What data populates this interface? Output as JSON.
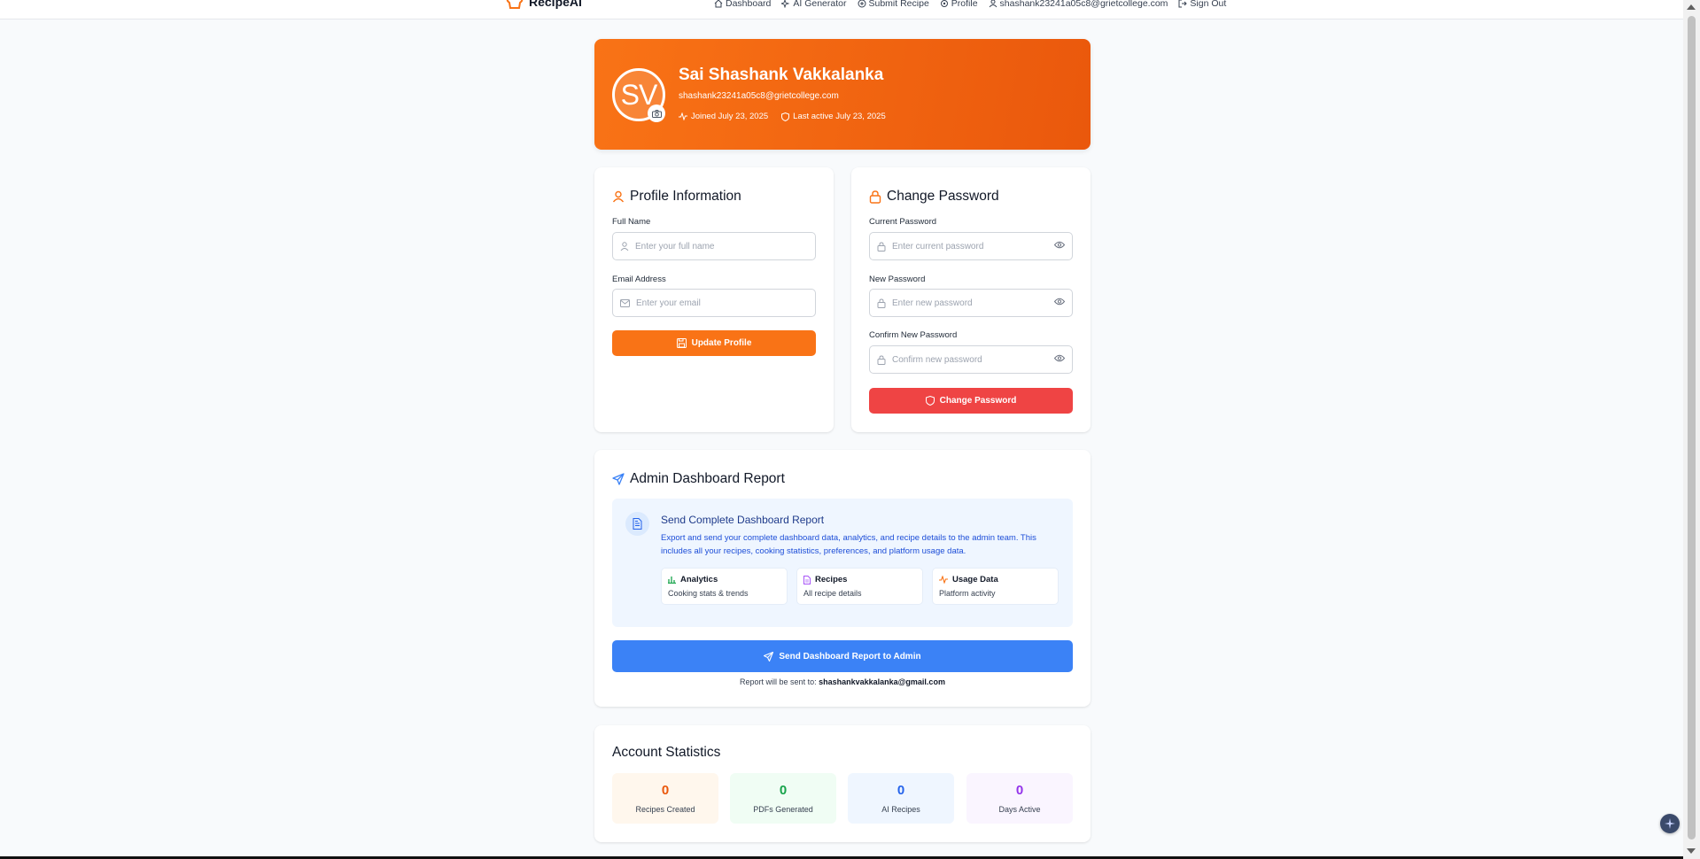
{
  "brand": {
    "name": "RecipeAI"
  },
  "nav": {
    "items": [
      {
        "label": "Dashboard",
        "icon": "home-icon"
      },
      {
        "label": "AI Generator",
        "icon": "sparkles-icon"
      },
      {
        "label": "Submit Recipe",
        "icon": "plus-circle-icon"
      },
      {
        "label": "Profile",
        "icon": "settings-icon"
      }
    ],
    "user_email": "shashank23241a05c8@grietcollege.com",
    "sign_out": "Sign Out"
  },
  "profile_header": {
    "initials": "SV",
    "name": "Sai Shashank Vakkalanka",
    "email": "shashank23241a05c8@grietcollege.com",
    "joined": "Joined July 23, 2025",
    "last_active": "Last active July 23, 2025"
  },
  "profile_info": {
    "title": "Profile Information",
    "full_name_label": "Full Name",
    "full_name_placeholder": "Enter your full name",
    "full_name_value": "",
    "email_label": "Email Address",
    "email_placeholder": "Enter your email",
    "email_value": "",
    "update_button": "Update Profile"
  },
  "change_password": {
    "title": "Change Password",
    "current_label": "Current Password",
    "current_placeholder": "Enter current password",
    "new_label": "New Password",
    "new_placeholder": "Enter new password",
    "confirm_label": "Confirm New Password",
    "confirm_placeholder": "Confirm new password",
    "submit_button": "Change Password"
  },
  "admin_report": {
    "title": "Admin Dashboard Report",
    "box_title": "Send Complete Dashboard Report",
    "box_desc": "Export and send your complete dashboard data, analytics, and recipe details to the admin team. This includes all your recipes, cooking statistics, preferences, and platform usage data.",
    "features": [
      {
        "title": "Analytics",
        "subtitle": "Cooking stats & trends"
      },
      {
        "title": "Recipes",
        "subtitle": "All recipe details"
      },
      {
        "title": "Usage Data",
        "subtitle": "Platform activity"
      }
    ],
    "send_button": "Send Dashboard Report to Admin",
    "note_prefix": "Report will be sent to:",
    "note_email": "shashankvakkalanka@gmail.com"
  },
  "account_stats": {
    "title": "Account Statistics",
    "items": [
      {
        "value": "0",
        "label": "Recipes Created",
        "color": "#ea580c",
        "bg": "#fff7ed"
      },
      {
        "value": "0",
        "label": "PDFs Generated",
        "color": "#16a34a",
        "bg": "#f0fdf4"
      },
      {
        "value": "0",
        "label": "AI Recipes",
        "color": "#2563eb",
        "bg": "#eff6ff"
      },
      {
        "value": "0",
        "label": "Days Active",
        "color": "#9333ea",
        "bg": "#faf5ff"
      }
    ]
  },
  "colors": {
    "accent": "#f97316",
    "danger": "#ef4444",
    "primary": "#3b82f6"
  }
}
